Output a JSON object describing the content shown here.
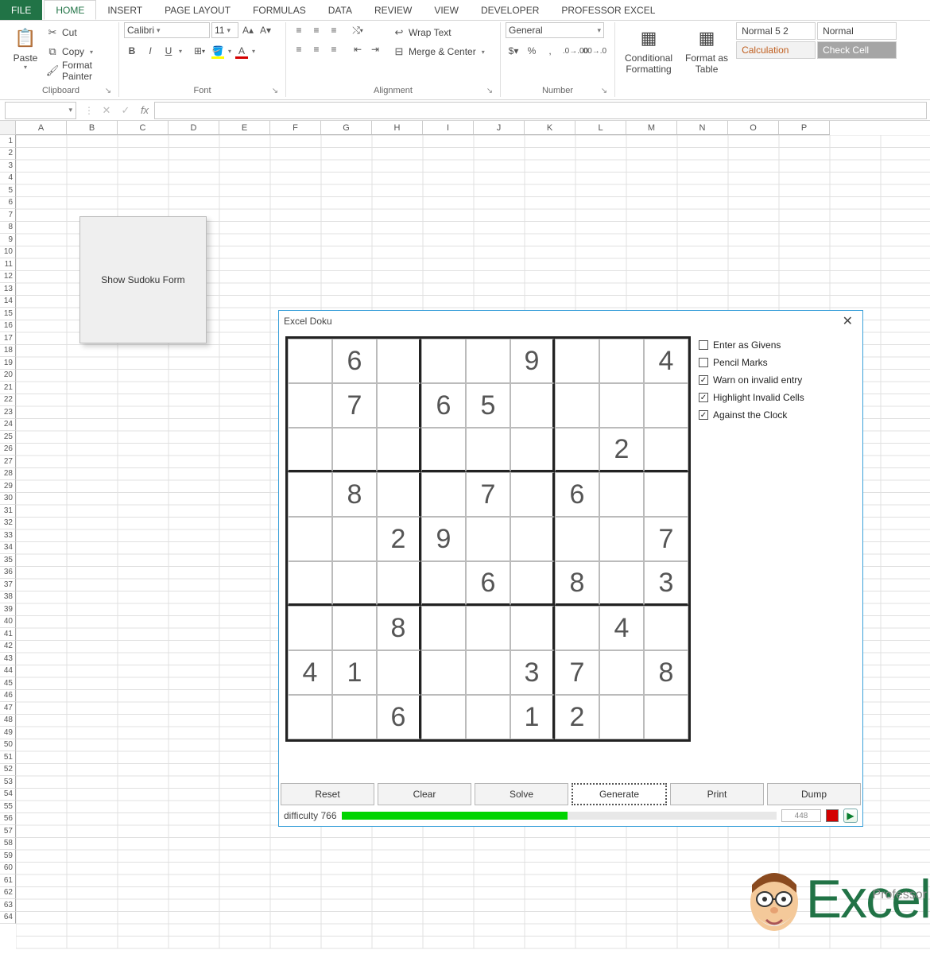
{
  "tabs": {
    "file": "FILE",
    "home": "HOME",
    "insert": "INSERT",
    "page_layout": "PAGE LAYOUT",
    "formulas": "FORMULAS",
    "data": "DATA",
    "review": "REVIEW",
    "view": "VIEW",
    "developer": "DEVELOPER",
    "professor_excel": "PROFESSOR EXCEL"
  },
  "ribbon": {
    "clipboard": {
      "label": "Clipboard",
      "paste": "Paste",
      "cut": "Cut",
      "copy": "Copy",
      "format_painter": "Format Painter"
    },
    "font": {
      "label": "Font",
      "name": "Calibri",
      "size": "11",
      "bold": "B",
      "italic": "I",
      "underline": "U"
    },
    "alignment": {
      "label": "Alignment",
      "wrap": "Wrap Text",
      "merge": "Merge & Center"
    },
    "number": {
      "label": "Number",
      "format": "General"
    },
    "styles": {
      "cond_format": "Conditional\nFormatting",
      "format_as_table": "Format as\nTable",
      "normal52": "Normal 5 2",
      "normal": "Normal",
      "calculation": "Calculation",
      "check_cell": "Check Cell"
    }
  },
  "formula_bar": {
    "name_box": "",
    "fx": "fx",
    "value": ""
  },
  "grid": {
    "columns": [
      "A",
      "B",
      "C",
      "D",
      "E",
      "F",
      "G",
      "H",
      "I",
      "J",
      "K",
      "L",
      "M",
      "N",
      "O",
      "P"
    ],
    "rows": 64,
    "button_label": "Show Sudoku Form"
  },
  "dialog": {
    "title": "Excel Doku",
    "options": [
      {
        "label": "Enter as Givens",
        "checked": false
      },
      {
        "label": "Pencil Marks",
        "checked": false
      },
      {
        "label": "Warn on invalid entry",
        "checked": true
      },
      {
        "label": "Highlight Invalid Cells",
        "checked": true
      },
      {
        "label": "Against the Clock",
        "checked": true
      }
    ],
    "actions": [
      "Reset",
      "Clear",
      "Solve",
      "Generate",
      "Print",
      "Dump"
    ],
    "difficulty": "difficulty 766",
    "progress_pct": 52,
    "timer": "448",
    "sudoku": [
      [
        "",
        "6",
        "",
        "",
        "",
        "9",
        "",
        "",
        "4"
      ],
      [
        "",
        "7",
        "",
        "6",
        "5",
        "",
        "",
        "",
        ""
      ],
      [
        "",
        "",
        "",
        "",
        "",
        "",
        "",
        "2",
        ""
      ],
      [
        "",
        "8",
        "",
        "",
        "7",
        "",
        "6",
        "",
        ""
      ],
      [
        "",
        "",
        "2",
        "9",
        "",
        "",
        "",
        "",
        "7"
      ],
      [
        "",
        "",
        "",
        "",
        "6",
        "",
        "8",
        "",
        "3"
      ],
      [
        "",
        "",
        "8",
        "",
        "",
        "",
        "",
        "4",
        ""
      ],
      [
        "4",
        "1",
        "",
        "",
        "",
        "3",
        "7",
        "",
        "8"
      ],
      [
        "",
        "",
        "6",
        "",
        "",
        "1",
        "2",
        "",
        ""
      ]
    ]
  },
  "logo": {
    "big": "Excel",
    "small": "Professor"
  }
}
